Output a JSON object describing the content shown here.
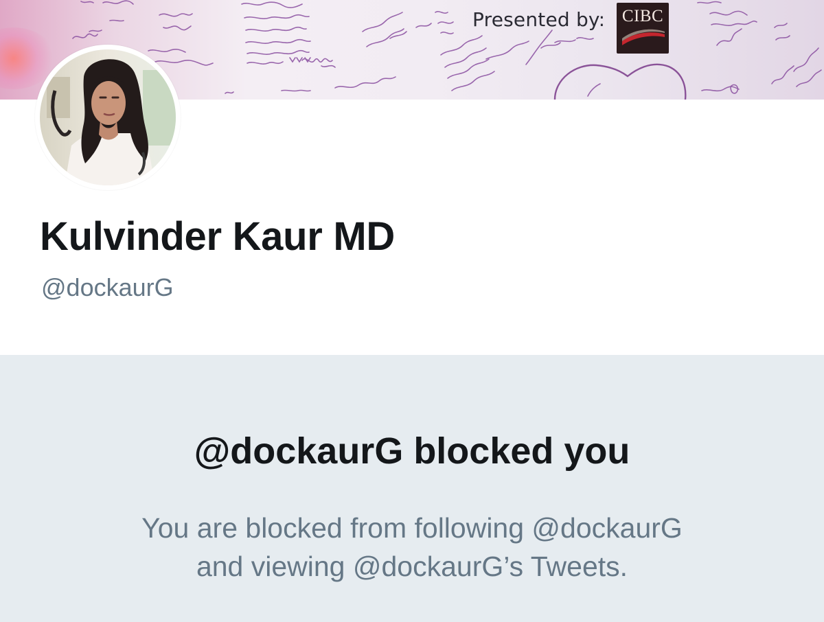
{
  "banner": {
    "presented_text": "Presented by:",
    "sponsor_logo_text": "CIBC"
  },
  "profile": {
    "display_name": "Kulvinder Kaur MD",
    "handle": "@dockaurG"
  },
  "blocked": {
    "title": "@dockaurG blocked you",
    "description_line1": "You are blocked from following @dockaurG",
    "description_line2": "and viewing @dockaurG’s Tweets."
  },
  "colors": {
    "primary_text": "#14171a",
    "secondary_text": "#657786",
    "panel_background": "#e6ecf0",
    "page_background": "#ffffff"
  }
}
